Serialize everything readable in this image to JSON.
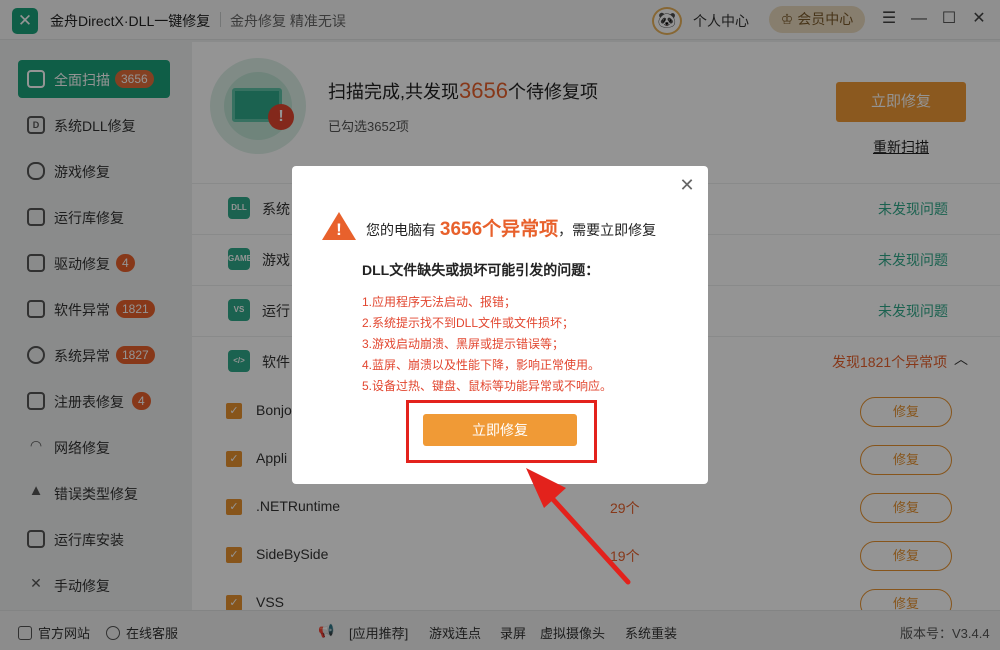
{
  "titlebar": {
    "app_name": "金舟DirectX·DLL一键修复",
    "slogan": "金舟修复 精准无误",
    "personal_center": "个人中心",
    "vip_center": "会员中心"
  },
  "sidebar": {
    "items": [
      {
        "label": "全面扫描",
        "badge": "3656",
        "icon": "scan-icon",
        "active": true
      },
      {
        "label": "系统DLL修复",
        "badge": "",
        "icon": "dll-icon"
      },
      {
        "label": "游戏修复",
        "badge": "",
        "icon": "gamepad-icon"
      },
      {
        "label": "运行库修复",
        "badge": "",
        "icon": "vs-icon"
      },
      {
        "label": "驱动修复",
        "badge": "4",
        "icon": "driver-icon"
      },
      {
        "label": "软件异常",
        "badge": "1821",
        "icon": "code-icon"
      },
      {
        "label": "系统异常",
        "badge": "1827",
        "icon": "gear-icon"
      },
      {
        "label": "注册表修复",
        "badge": "4",
        "icon": "registry-icon"
      },
      {
        "label": "网络修复",
        "badge": "",
        "icon": "wifi-icon"
      },
      {
        "label": "错误类型修复",
        "badge": "",
        "icon": "warning-icon"
      },
      {
        "label": "运行库安装",
        "badge": "",
        "icon": "install-icon"
      },
      {
        "label": "手动修复",
        "badge": "",
        "icon": "wrench-icon"
      }
    ]
  },
  "summary": {
    "prefix": "扫描完成,共发现",
    "count": "3656",
    "suffix": "个待修复项",
    "checked": "已勾选3652项",
    "fix_now": "立即修复",
    "rescan": "重新扫描"
  },
  "categories": [
    {
      "label": "系统",
      "status": "未发现问题",
      "icon_text": "DLL"
    },
    {
      "label": "游戏",
      "status": "未发现问题",
      "icon_text": "GAME"
    },
    {
      "label": "运行",
      "status": "未发现问题",
      "icon_text": "VS"
    },
    {
      "label": "软件",
      "status": "发现1821个异常项",
      "icon_text": "</>"
    }
  ],
  "sub_items": [
    {
      "name": "Bonjo",
      "count": "",
      "fix": "修复"
    },
    {
      "name": "Appli",
      "count": "",
      "fix": "修复"
    },
    {
      "name": ".NETRuntime",
      "count": "29个",
      "fix": "修复"
    },
    {
      "name": "SideBySide",
      "count": "19个",
      "fix": "修复"
    },
    {
      "name": "VSS",
      "count": "",
      "fix": "修复"
    }
  ],
  "dialog": {
    "heading_prefix": "您的电脑有",
    "heading_count": "3656个异常项",
    "heading_suffix": "，需要立即修复",
    "subtitle": "DLL文件缺失或损坏可能引发的问题：",
    "issues": [
      "1.应用程序无法启动、报错；",
      "2.系统提示找不到DLL文件或文件损坏；",
      "3.游戏启动崩溃、黑屏或提示错误等；",
      "4.蓝屏、崩溃以及性能下降，影响正常使用。",
      "5.设备过热、键盘、鼠标等功能异常或不响应。"
    ],
    "fix_button": "立即修复"
  },
  "footer": {
    "website": "官方网站",
    "service": "在线客服",
    "recommend": "[应用推荐]",
    "links": [
      "游戏连点",
      "录屏",
      "虚拟摄像头",
      "系统重装"
    ],
    "version": "版本号：V3.4.4"
  },
  "colors": {
    "accent": "#1aa37a",
    "orange": "#f09a36",
    "warn": "#e8612c",
    "red": "#e3221c"
  }
}
